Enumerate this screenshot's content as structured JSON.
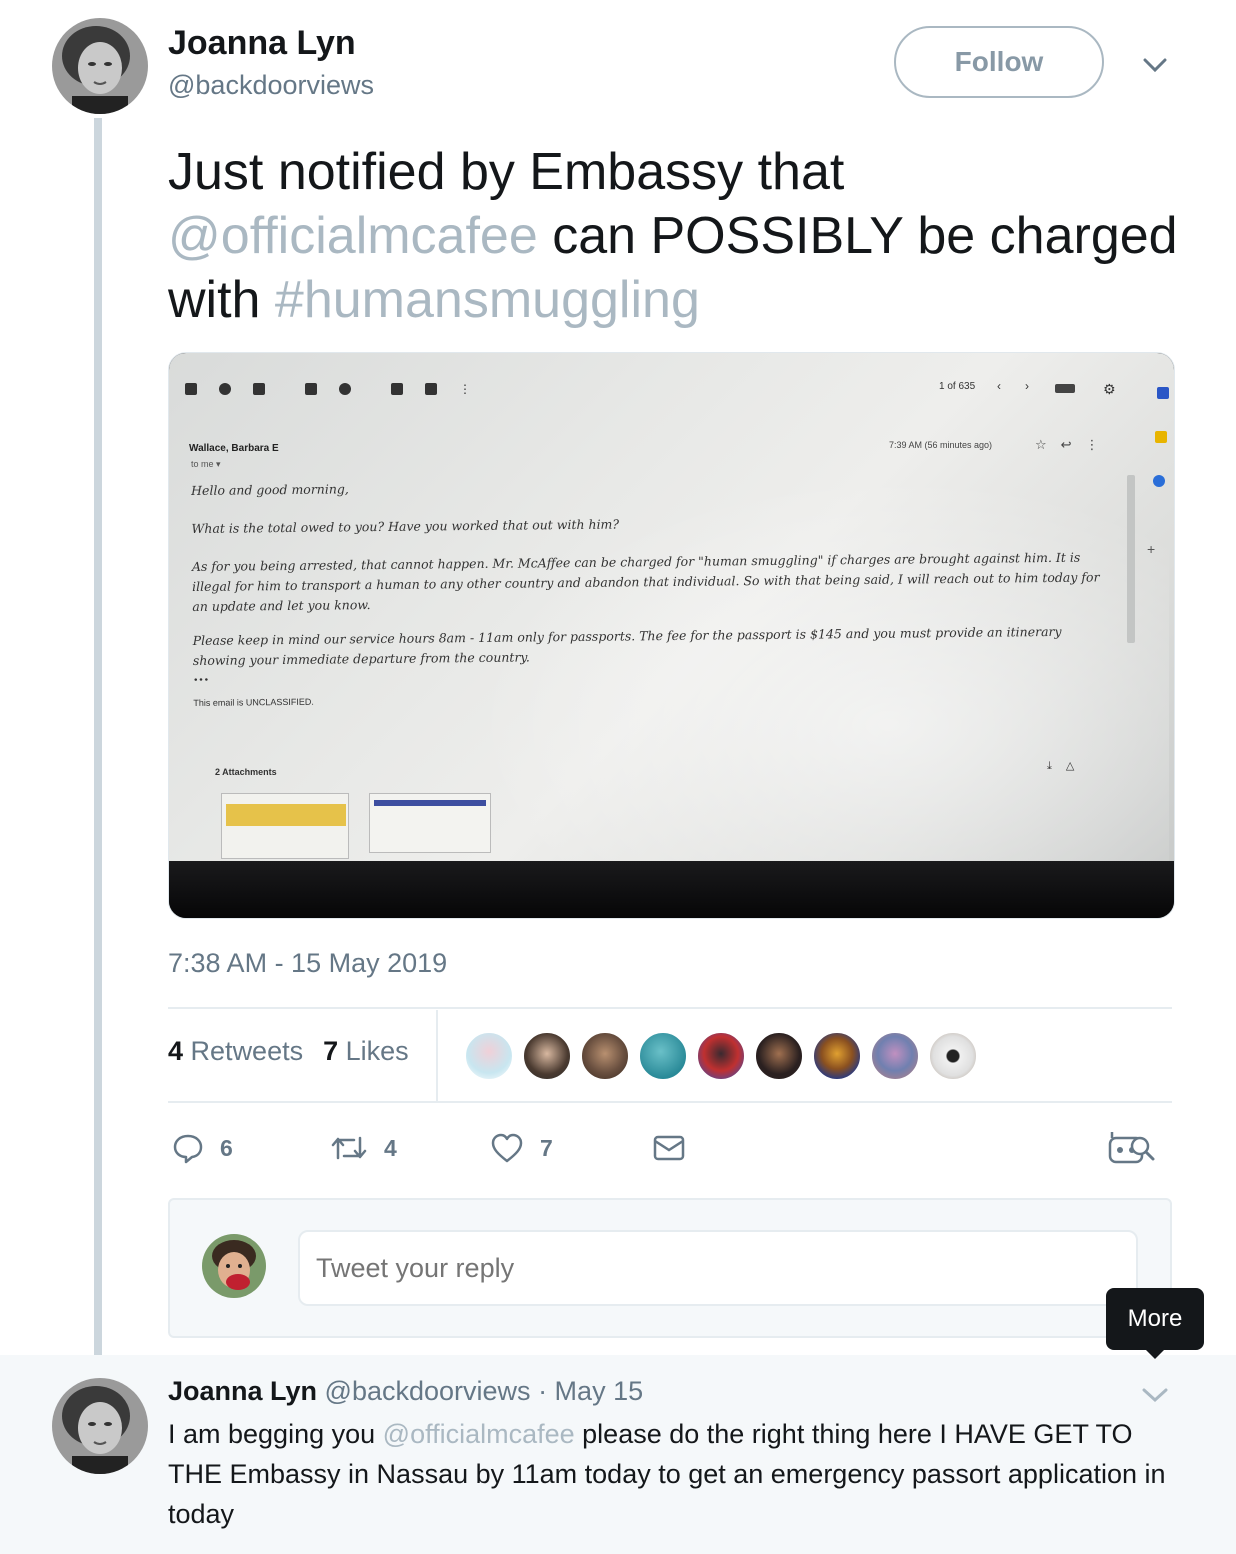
{
  "tweet": {
    "author_name": "Joanna Lyn",
    "author_handle": "@backdoorviews",
    "follow_label": "Follow",
    "text_part1": "Just notified by Embassy that ",
    "mention": "@officialmcafee",
    "text_part2": " can POSSIBLY be charged with ",
    "hashtag": "#humansmuggling",
    "timestamp": "7:38 AM - 15 May 2019"
  },
  "email_photo": {
    "pager": "1 of 635",
    "sender": "Wallace, Barbara E",
    "to_me": "to me ▾",
    "time": "7:39 AM (56 minutes ago)",
    "greeting": "Hello and good morning,",
    "para1": "What is the total owed to you? Have you worked that out with him?",
    "para2": "As for you being arrested, that cannot happen.   Mr.   McAffee can be charged for \"human smuggling\" if charges are brought against him.   It is illegal for him to transport a human to any other country and abandon that individual.   So with that being said, I will reach out to him today for an update and let you know.",
    "para3": "Please keep in mind our service hours 8am - 11am only for passports.   The fee for the passport is $145 and you must provide an itinerary showing your immediate departure from the country.",
    "ellipsis": "•••",
    "classification": "This email is UNCLASSIFIED.",
    "attachments_title": "2 Attachments"
  },
  "stats": {
    "retweets_count": "4",
    "retweets_label": "Retweets",
    "likes_count": "7",
    "likes_label": "Likes"
  },
  "actions": {
    "replies": "6",
    "retweets": "4",
    "likes": "7"
  },
  "reply_box": {
    "placeholder": "Tweet your reply"
  },
  "tooltip": {
    "label": "More"
  },
  "reply_tweet": {
    "author_name": "Joanna Lyn",
    "author_handle": "@backdoorviews",
    "date": "· May 15",
    "text_part1": "I am begging you ",
    "mention": "@officialmcafee",
    "text_part2": " please do the right thing here I HAVE GET TO THE Embassy in Nassau by 11am today to get an emergency passort application in today"
  },
  "colors": {
    "link": "#aab8c2",
    "muted": "#657786",
    "border": "#e6ecf0",
    "reply_bg": "#f5f8fa"
  }
}
